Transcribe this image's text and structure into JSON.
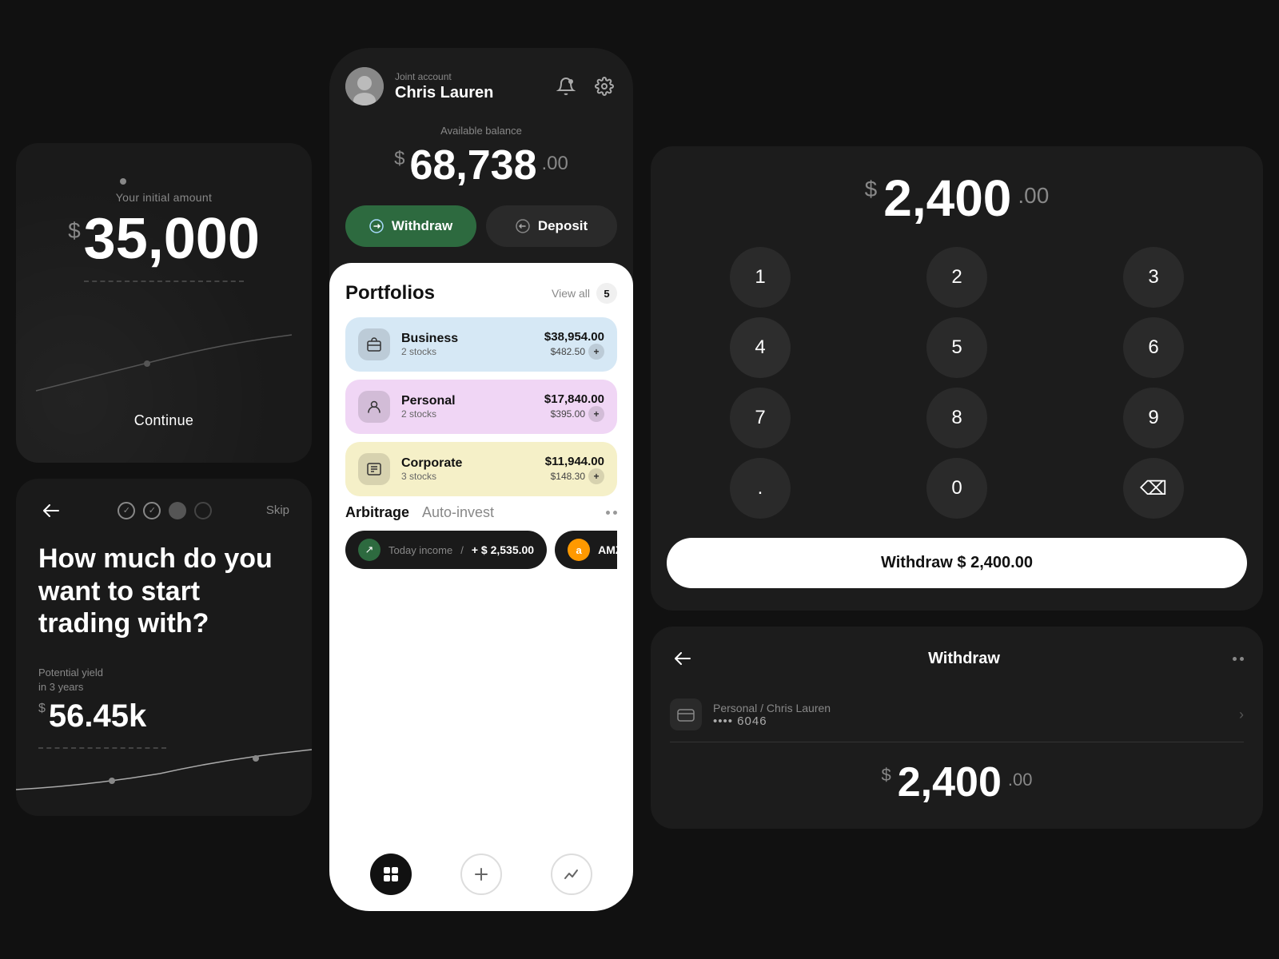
{
  "left_col": {
    "card_initial": {
      "label": "Your initial amount",
      "dollar_sign": "$",
      "amount": "35,000",
      "continue_label": "Continue"
    },
    "card_trading": {
      "question": "How much do you want to start trading with?",
      "yield_label_line1": "Potential yield",
      "yield_label_line2": "in 3 years",
      "yield_dollar": "$",
      "yield_value": "56.45k",
      "skip_label": "Skip"
    }
  },
  "mid_col": {
    "account_type": "Joint account",
    "account_name": "Chris Lauren",
    "balance_label": "Available balance",
    "balance_dollar": "$",
    "balance_main": "68,738",
    "balance_cents": ".00",
    "withdraw_label": "Withdraw",
    "deposit_label": "Deposit",
    "portfolios_title": "Portfolios",
    "view_all_label": "View all",
    "view_all_count": "5",
    "portfolios": [
      {
        "name": "Business",
        "stocks": "2 stocks",
        "main_value": "$38,954.00",
        "change": "$482.50",
        "color": "blue"
      },
      {
        "name": "Personal",
        "stocks": "2 stocks",
        "main_value": "$17,840.00",
        "change": "$395.00",
        "color": "pink"
      },
      {
        "name": "Corporate",
        "stocks": "3 stocks",
        "main_value": "$11,944.00",
        "change": "$148.30",
        "color": "yellow"
      }
    ],
    "arbitrage_tab": "Arbitrage",
    "autoinvest_tab": "Auto-invest",
    "today_income_label": "Today income",
    "today_income_sep": "/",
    "today_income_value": "+ $ 2,535.00",
    "amzn_label": "AMZN"
  },
  "right_col": {
    "keypad_dollar": "$",
    "keypad_amount": "2,400",
    "keypad_cents": ".00",
    "keys": [
      "1",
      "2",
      "3",
      "4",
      "5",
      "6",
      "7",
      "8",
      "9",
      ".",
      "0",
      "⌫"
    ],
    "withdraw_btn_label": "Withdraw $ 2,400",
    "withdraw_btn_cents": ".00",
    "withdraw_card": {
      "title": "Withdraw",
      "account_path": "Personal / Chris Lauren",
      "account_number": "•••• 6046",
      "confirm_dollar": "$",
      "confirm_amount": "2,400",
      "confirm_cents": ".00"
    }
  }
}
